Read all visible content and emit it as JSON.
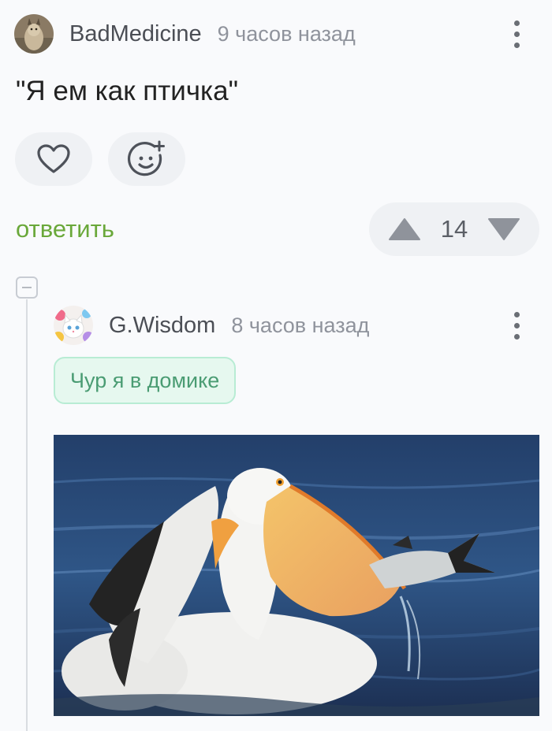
{
  "comment": {
    "author": "BadMedicine",
    "time": "9 часов назад",
    "text": "\"Я ем как птичка\"",
    "reply_label": "ответить",
    "rating": "14"
  },
  "reply": {
    "author": "G.Wisdom",
    "time": "8 часов назад",
    "tag": "Чур я в домике",
    "image": "pelican catching fish"
  },
  "icons": {
    "like": "heart-icon",
    "reaction": "add-emoji-icon",
    "upvote": "triangle-up-icon",
    "downvote": "triangle-down-icon",
    "more": "vertical-dots-icon",
    "collapse": "minus-icon"
  },
  "colors": {
    "reply_link": "#6aa83a",
    "tag_text": "#4a9c73",
    "tag_bg": "#e6f8ef"
  }
}
